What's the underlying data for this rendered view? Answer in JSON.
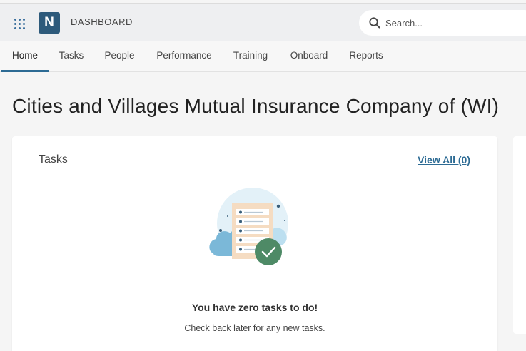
{
  "header": {
    "logo_letter": "N",
    "app_title": "DASHBOARD",
    "search_placeholder": "Search..."
  },
  "nav": {
    "tabs": [
      {
        "label": "Home",
        "active": true
      },
      {
        "label": "Tasks"
      },
      {
        "label": "People"
      },
      {
        "label": "Performance"
      },
      {
        "label": "Training"
      },
      {
        "label": "Onboard"
      },
      {
        "label": "Reports"
      }
    ]
  },
  "main": {
    "page_title": "Cities and Villages Mutual Insurance Company of (WI)",
    "tasks_card": {
      "title": "Tasks",
      "view_all": "View All (0)",
      "empty_heading": "You have zero tasks to do!",
      "empty_subtext": "Check back later for any new tasks."
    }
  },
  "colors": {
    "accent": "#2d6b94",
    "logo_bg": "#2d5a7b",
    "check_badge": "#4e8a66"
  }
}
